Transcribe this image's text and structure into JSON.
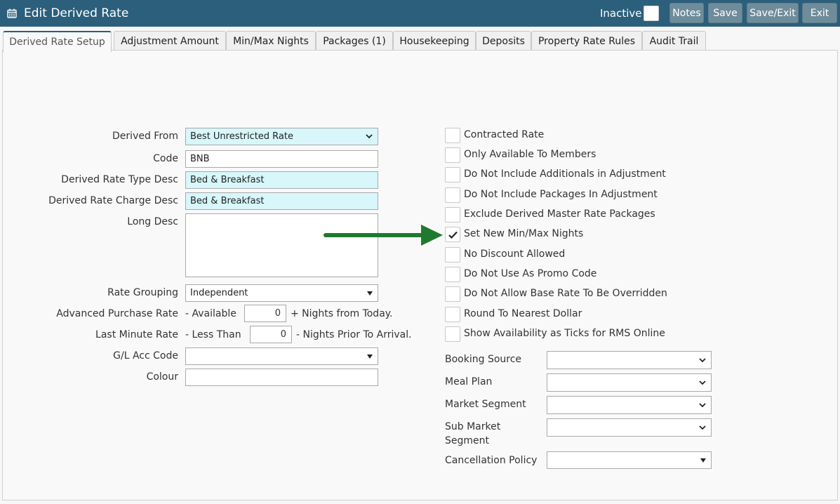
{
  "titlebar": {
    "title": "Edit Derived Rate",
    "inactive_label": "Inactive",
    "buttons": {
      "notes": "Notes",
      "save": "Save",
      "save_exit": "Save/Exit",
      "exit": "Exit"
    }
  },
  "tabs": [
    {
      "label": "Derived Rate Setup"
    },
    {
      "label": "Adjustment Amount"
    },
    {
      "label": "Min/Max Nights"
    },
    {
      "label": "Packages (1)"
    },
    {
      "label": "Housekeeping"
    },
    {
      "label": "Deposits"
    },
    {
      "label": "Property Rate Rules"
    },
    {
      "label": "Audit Trail"
    }
  ],
  "form": {
    "derived_from": {
      "label": "Derived From",
      "value": "Best Unrestricted Rate"
    },
    "code": {
      "label": "Code",
      "value": "BNB"
    },
    "type_desc": {
      "label": "Derived Rate Type Desc",
      "value": "Bed & Breakfast"
    },
    "charge_desc": {
      "label": "Derived Rate Charge Desc",
      "value": "Bed & Breakfast"
    },
    "long_desc": {
      "label": "Long Desc",
      "value": ""
    },
    "rate_grouping": {
      "label": "Rate Grouping",
      "value": "Independent"
    },
    "advanced_purchase": {
      "label": "Advanced Purchase Rate",
      "prefix": "- Available",
      "value": "0",
      "suffix": "+ Nights from Today."
    },
    "last_minute": {
      "label": "Last Minute Rate",
      "prefix": "- Less Than",
      "value": "0",
      "suffix": "- Nights Prior To Arrival."
    },
    "gl_code": {
      "label": "G/L Acc Code",
      "value": ""
    },
    "colour": {
      "label": "Colour",
      "value": ""
    }
  },
  "options": [
    {
      "label": "Contracted Rate",
      "checked": false
    },
    {
      "label": "Only Available To Members",
      "checked": false
    },
    {
      "label": "Do Not Include Additionals in Adjustment",
      "checked": false
    },
    {
      "label": "Do Not Include Packages In Adjustment",
      "checked": false
    },
    {
      "label": "Exclude Derived Master Rate Packages",
      "checked": false
    },
    {
      "label": "Set New Min/Max Nights",
      "checked": true
    },
    {
      "label": "No Discount Allowed",
      "checked": false
    },
    {
      "label": "Do Not Use As Promo Code",
      "checked": false
    },
    {
      "label": "Do Not Allow Base Rate To Be Overridden",
      "checked": false
    },
    {
      "label": "Round To Nearest Dollar",
      "checked": false
    },
    {
      "label": "Show Availability as Ticks for RMS Online",
      "checked": false
    }
  ],
  "right_selects": {
    "booking_source": {
      "label": "Booking Source",
      "value": ""
    },
    "meal_plan": {
      "label": "Meal Plan",
      "value": ""
    },
    "market_segment": {
      "label": "Market Segment",
      "value": ""
    },
    "sub_market_segment": {
      "label_1": "Sub Market",
      "label_2": "Segment",
      "value": ""
    },
    "cancellation_policy": {
      "label": "Cancellation Policy",
      "value": ""
    }
  },
  "colors": {
    "header": "#2b5f7b",
    "highlight_field": "#d7f7fb",
    "arrow": "#1e7a2e"
  }
}
